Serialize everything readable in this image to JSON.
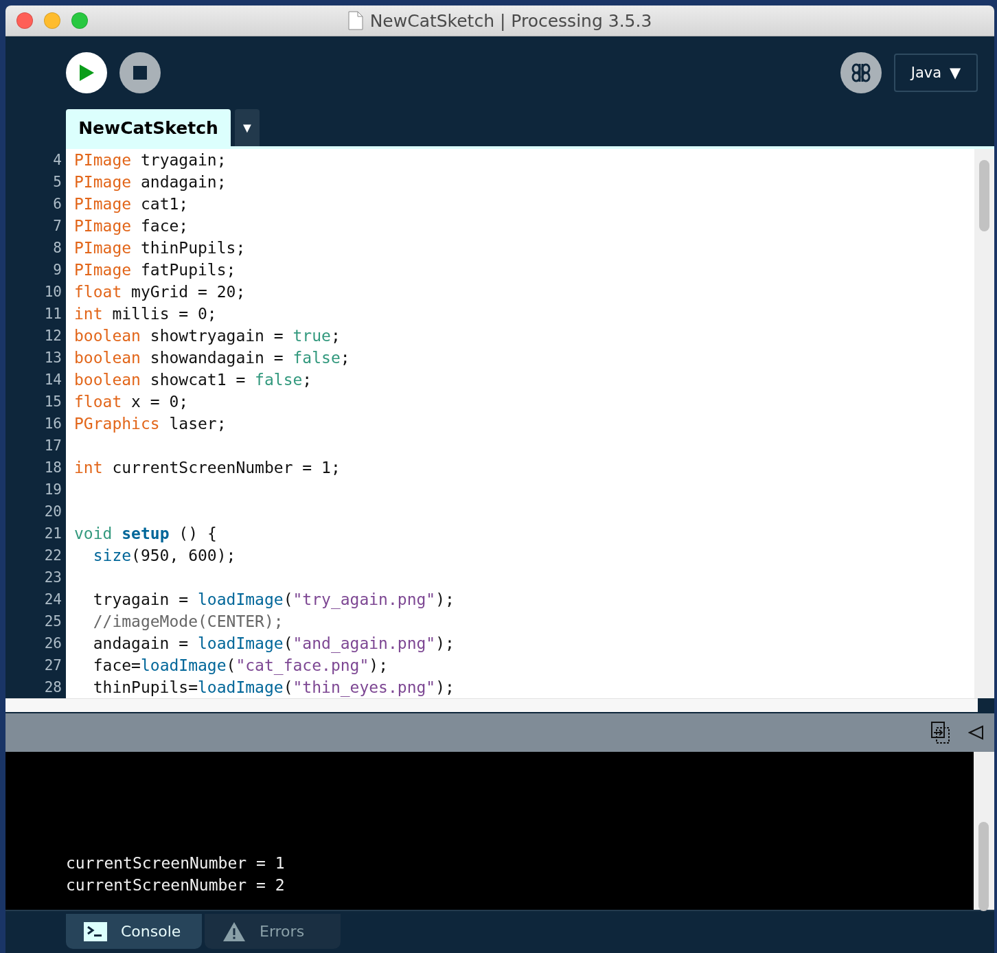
{
  "window": {
    "title": "NewCatSketch | Processing 3.5.3"
  },
  "toolbar": {
    "mode": "Java",
    "mode_arrow": "▼"
  },
  "tabs": [
    {
      "label": "NewCatSketch",
      "selected": true
    }
  ],
  "tab_menu": "▼",
  "editor": {
    "lines": [
      {
        "number": "4",
        "tokens": [
          {
            "kind": "type",
            "text": "PImage"
          },
          {
            "kind": "plain",
            "text": " tryagain;"
          }
        ]
      },
      {
        "number": "5",
        "tokens": [
          {
            "kind": "type",
            "text": "PImage"
          },
          {
            "kind": "plain",
            "text": " andagain;"
          }
        ]
      },
      {
        "number": "6",
        "tokens": [
          {
            "kind": "type",
            "text": "PImage"
          },
          {
            "kind": "plain",
            "text": " cat1;"
          }
        ]
      },
      {
        "number": "7",
        "tokens": [
          {
            "kind": "type",
            "text": "PImage"
          },
          {
            "kind": "plain",
            "text": " face;"
          }
        ]
      },
      {
        "number": "8",
        "tokens": [
          {
            "kind": "type",
            "text": "PImage"
          },
          {
            "kind": "plain",
            "text": " thinPupils;"
          }
        ]
      },
      {
        "number": "9",
        "tokens": [
          {
            "kind": "type",
            "text": "PImage"
          },
          {
            "kind": "plain",
            "text": " fatPupils;"
          }
        ]
      },
      {
        "number": "10",
        "tokens": [
          {
            "kind": "type",
            "text": "float"
          },
          {
            "kind": "plain",
            "text": " myGrid = 20;"
          }
        ]
      },
      {
        "number": "11",
        "tokens": [
          {
            "kind": "type",
            "text": "int"
          },
          {
            "kind": "plain",
            "text": " millis = 0;"
          }
        ]
      },
      {
        "number": "12",
        "tokens": [
          {
            "kind": "type",
            "text": "boolean"
          },
          {
            "kind": "plain",
            "text": " showtryagain = "
          },
          {
            "kind": "literal",
            "text": "true"
          },
          {
            "kind": "plain",
            "text": ";"
          }
        ]
      },
      {
        "number": "13",
        "tokens": [
          {
            "kind": "type",
            "text": "boolean"
          },
          {
            "kind": "plain",
            "text": " showandagain = "
          },
          {
            "kind": "literal",
            "text": "false"
          },
          {
            "kind": "plain",
            "text": ";"
          }
        ]
      },
      {
        "number": "14",
        "tokens": [
          {
            "kind": "type",
            "text": "boolean"
          },
          {
            "kind": "plain",
            "text": " showcat1 = "
          },
          {
            "kind": "literal",
            "text": "false"
          },
          {
            "kind": "plain",
            "text": ";"
          }
        ]
      },
      {
        "number": "15",
        "tokens": [
          {
            "kind": "type",
            "text": "float"
          },
          {
            "kind": "plain",
            "text": " x = 0;"
          }
        ]
      },
      {
        "number": "16",
        "tokens": [
          {
            "kind": "type",
            "text": "PGraphics"
          },
          {
            "kind": "plain",
            "text": " laser;"
          }
        ]
      },
      {
        "number": "17"
      },
      {
        "number": "18",
        "tokens": [
          {
            "kind": "type",
            "text": "int"
          },
          {
            "kind": "plain",
            "text": " currentScreenNumber = 1;"
          }
        ]
      },
      {
        "number": "19"
      },
      {
        "number": "20"
      },
      {
        "number": "21",
        "tokens": [
          {
            "kind": "literal",
            "text": "void "
          },
          {
            "kind": "method",
            "text": "setup"
          },
          {
            "kind": "plain",
            "text": " () {"
          }
        ]
      },
      {
        "number": "22",
        "indented": true,
        "tokens": [
          {
            "kind": "function",
            "text": "size"
          },
          {
            "kind": "plain",
            "text": "(950, 600);"
          }
        ]
      },
      {
        "number": "23"
      },
      {
        "number": "24",
        "indented": true,
        "tokens": [
          {
            "kind": "plain",
            "text": "tryagain = "
          },
          {
            "kind": "function",
            "text": "loadImage"
          },
          {
            "kind": "plain",
            "text": "("
          },
          {
            "kind": "string",
            "text": "\"try_again.png\""
          },
          {
            "kind": "plain",
            "text": ");"
          }
        ]
      },
      {
        "number": "25",
        "indented": true,
        "tokens": [
          {
            "kind": "comment",
            "text": "//imageMode(CENTER);"
          }
        ]
      },
      {
        "number": "26",
        "indented": true,
        "tokens": [
          {
            "kind": "plain",
            "text": "andagain = "
          },
          {
            "kind": "function",
            "text": "loadImage"
          },
          {
            "kind": "plain",
            "text": "("
          },
          {
            "kind": "string",
            "text": "\"and_again.png\""
          },
          {
            "kind": "plain",
            "text": ");"
          }
        ]
      },
      {
        "number": "27",
        "indented": true,
        "tokens": [
          {
            "kind": "plain",
            "text": "face="
          },
          {
            "kind": "function",
            "text": "loadImage"
          },
          {
            "kind": "plain",
            "text": "("
          },
          {
            "kind": "string",
            "text": "\"cat_face.png\""
          },
          {
            "kind": "plain",
            "text": ");"
          }
        ]
      },
      {
        "number": "28",
        "indented": true,
        "tokens": [
          {
            "kind": "plain",
            "text": "thinPupils="
          },
          {
            "kind": "function",
            "text": "loadImage"
          },
          {
            "kind": "plain",
            "text": "("
          },
          {
            "kind": "string",
            "text": "\"thin_eyes.png\""
          },
          {
            "kind": "plain",
            "text": ");"
          }
        ]
      }
    ]
  },
  "console": {
    "lines": [
      "currentScreenNumber = 1",
      "currentScreenNumber = 2"
    ]
  },
  "bottom_tabs": [
    {
      "label": "Console",
      "selected": true,
      "kind": "console"
    },
    {
      "label": "Errors",
      "selected": false,
      "kind": "errors"
    }
  ]
}
